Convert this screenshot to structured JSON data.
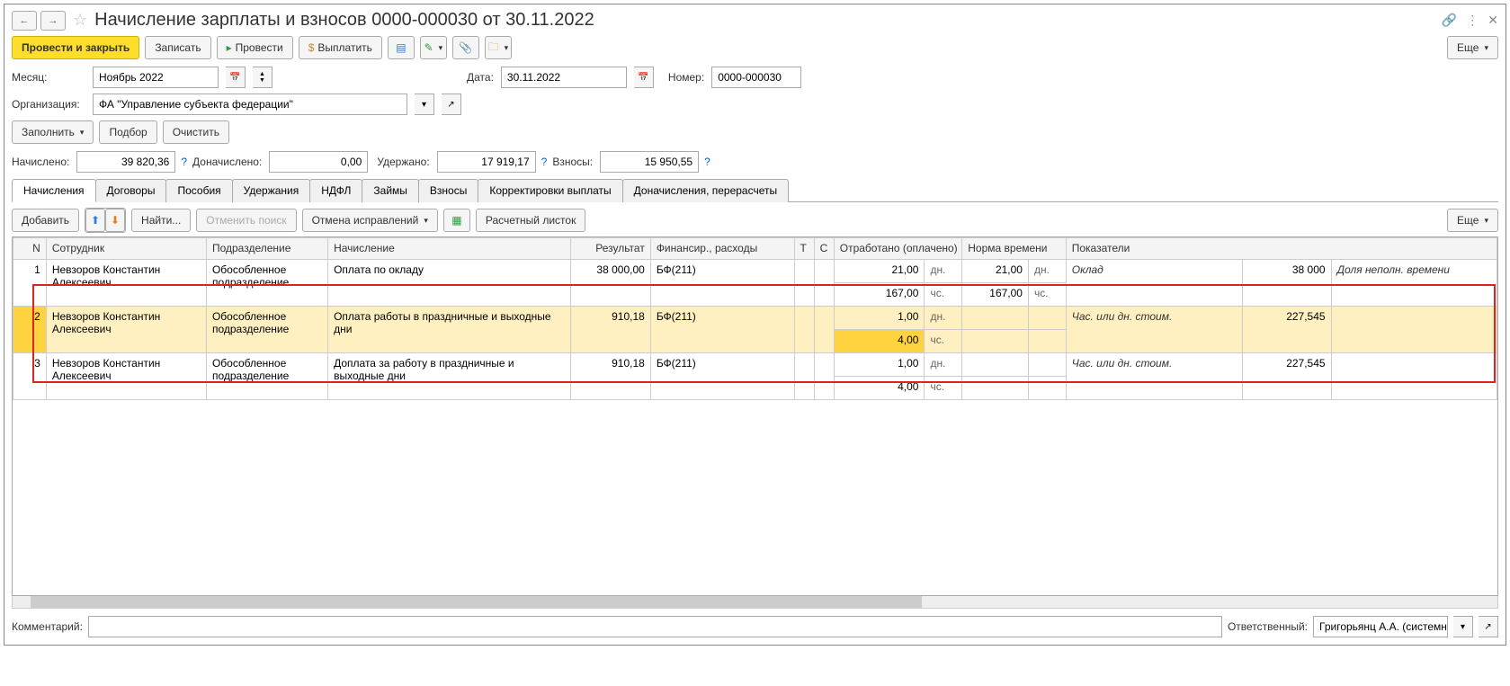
{
  "window": {
    "title": "Начисление зарплаты и взносов 0000-000030 от 30.11.2022"
  },
  "toolbar": {
    "post_close": "Провести и закрыть",
    "save": "Записать",
    "post": "Провести",
    "pay": "Выплатить",
    "more": "Еще"
  },
  "form": {
    "month_label": "Месяц:",
    "month_value": "Ноябрь 2022",
    "date_label": "Дата:",
    "date_value": "30.11.2022",
    "number_label": "Номер:",
    "number_value": "0000-000030",
    "org_label": "Организация:",
    "org_value": "ФА \"Управление субъекта федерации\""
  },
  "toolbar2": {
    "fill": "Заполнить",
    "select": "Подбор",
    "clear": "Очистить"
  },
  "totals": {
    "accrued_label": "Начислено:",
    "accrued_value": "39 820,36",
    "addl_label": "Доначислено:",
    "addl_value": "0,00",
    "withheld_label": "Удержано:",
    "withheld_value": "17 919,17",
    "contrib_label": "Взносы:",
    "contrib_value": "15 950,55"
  },
  "tabs": [
    "Начисления",
    "Договоры",
    "Пособия",
    "Удержания",
    "НДФЛ",
    "Займы",
    "Взносы",
    "Корректировки выплаты",
    "Доначисления, перерасчеты"
  ],
  "table_toolbar": {
    "add": "Добавить",
    "find": "Найти...",
    "cancel_find": "Отменить поиск",
    "cancel_fix": "Отмена исправлений",
    "payslip": "Расчетный листок",
    "more": "Еще"
  },
  "columns": {
    "n": "N",
    "employee": "Сотрудник",
    "department": "Подразделение",
    "accrual": "Начисление",
    "result": "Результат",
    "finance": "Финансир., расходы",
    "t": "Т",
    "c": "С",
    "worked": "Отработано (оплачено)",
    "norm": "Норма времени",
    "indicators": "Показатели"
  },
  "units": {
    "days": "дн.",
    "hours": "чс."
  },
  "rows": [
    {
      "n": "1",
      "employee": "Невзоров Константин Алексеевич",
      "department": "Обособленное подразделение",
      "accrual": "Оплата по окладу",
      "result": "38 000,00",
      "finance": "БФ(211)",
      "worked_days": "21,00",
      "worked_hours": "167,00",
      "norm_days": "21,00",
      "norm_hours": "167,00",
      "indicator": "Оклад",
      "indicator_value": "38 000",
      "extra": "Доля неполн. времени"
    },
    {
      "n": "2",
      "employee": "Невзоров Константин Алексеевич",
      "department": "Обособленное подразделение",
      "accrual": "Оплата работы в праздничные и выходные дни",
      "result": "910,18",
      "finance": "БФ(211)",
      "worked_days": "1,00",
      "worked_hours": "4,00",
      "norm_days": "",
      "norm_hours": "",
      "indicator": "Час. или дн. стоим.",
      "indicator_value": "227,545",
      "extra": ""
    },
    {
      "n": "3",
      "employee": "Невзоров Константин Алексеевич",
      "department": "Обособленное подразделение",
      "accrual": "Доплата за работу в праздничные и выходные дни",
      "result": "910,18",
      "finance": "БФ(211)",
      "worked_days": "1,00",
      "worked_hours": "4,00",
      "norm_days": "",
      "norm_hours": "",
      "indicator": "Час. или дн. стоим.",
      "indicator_value": "227,545",
      "extra": ""
    }
  ],
  "bottom": {
    "comment_label": "Комментарий:",
    "responsible_label": "Ответственный:",
    "responsible_value": "Григорьянц А.А. (системн"
  }
}
